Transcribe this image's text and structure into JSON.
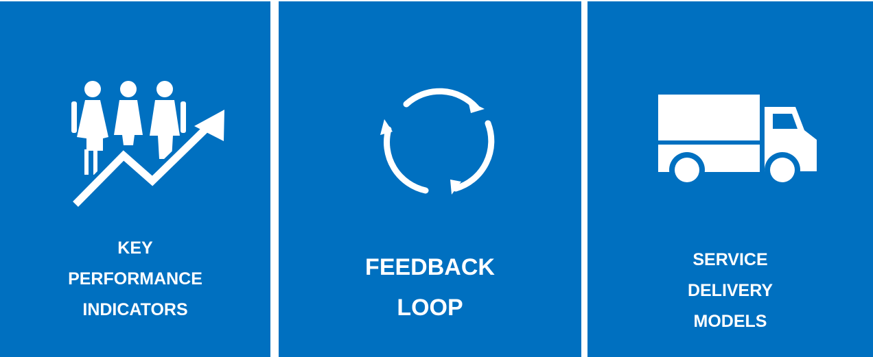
{
  "tiles": [
    {
      "icon": "people-growth-arrow-icon",
      "label_lines": [
        "KEY",
        "PERFORMANCE",
        "INDICATORS"
      ]
    },
    {
      "icon": "circular-arrows-icon",
      "label_lines": [
        "FEEDBACK",
        "LOOP"
      ]
    },
    {
      "icon": "delivery-truck-icon",
      "label_lines": [
        "SERVICE",
        "DELIVERY",
        "MODELS"
      ]
    }
  ],
  "colors": {
    "tile_background": "#0070C0",
    "foreground": "#FFFFFF",
    "page_background": "#FFFFFF"
  }
}
